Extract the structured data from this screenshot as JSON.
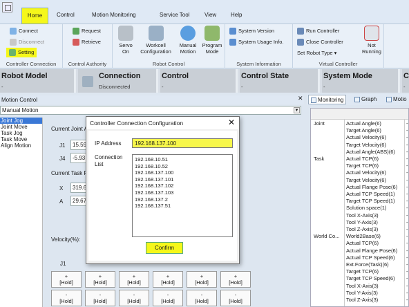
{
  "menu": {
    "items": [
      {
        "label": "Home",
        "active": true
      },
      {
        "label": "Control"
      },
      {
        "label": "Motion Monitoring"
      },
      {
        "label": "Service Tool"
      },
      {
        "label": "View"
      },
      {
        "label": "Help"
      }
    ]
  },
  "ribbon": {
    "controller_connection": {
      "title": "Controller Connection",
      "connect": "Connect",
      "disconnect": "Disconnect",
      "setting": "Setting"
    },
    "control_authority": {
      "title": "Control Authority",
      "request": "Request",
      "retrieve": "Retrieve"
    },
    "robot_control": {
      "title": "Robot Control",
      "servo_on": [
        "Servo",
        "On"
      ],
      "workcell": [
        "Workcell",
        "Configuration"
      ],
      "manual_motion": [
        "Manual",
        "Motion"
      ],
      "program_mode": [
        "Program",
        "Mode"
      ]
    },
    "system_information": {
      "title": "System Information",
      "system_version": "System Version",
      "system_usage": "System Usage Info."
    },
    "virtual_controller": {
      "title": "Virtual Controller",
      "run": "Run Controller",
      "close": "Close Controller",
      "set_robot_type": "Set Robot Type",
      "not_running": [
        "Not",
        "Running"
      ]
    }
  },
  "status": {
    "robot_model": {
      "label": "Robot Model",
      "value": "-"
    },
    "connection": {
      "label": "Connection",
      "value": "Disconnected"
    },
    "control": {
      "label": "Control",
      "value": "-"
    },
    "control_state": {
      "label": "Control State",
      "value": "-"
    },
    "system_mode": {
      "label": "System Mode",
      "value": "-"
    },
    "co": {
      "label": "Co",
      "value": "-"
    }
  },
  "motion_control": {
    "title": "Motion Control",
    "mode": "Manual Motion",
    "list": [
      "Joint Jog",
      "Joint Move",
      "Task Jog",
      "Task Move",
      "Align Motion"
    ],
    "current_joint_label": "Current Joint A",
    "j1_label": "J1",
    "j1_value": "15.59",
    "j4_label": "J4",
    "j4_value": "-5.93",
    "current_task_label": "Current Task P",
    "x_label": "X",
    "x_value": "319.6",
    "a_label": "A",
    "a_value": "29.67",
    "velocity_label": "Velocity(%):",
    "j1_bottom": "J1",
    "hold": "[Hold]",
    "plus": "+",
    "minus": "-"
  },
  "monitoring": {
    "tabs": [
      "Monitoring",
      "Graph",
      "Motio"
    ],
    "rows": [
      {
        "group": "Joint",
        "name": "Actual Angle(6)",
        "val": "-"
      },
      {
        "group": "",
        "name": "Target Angle(6)",
        "val": "-"
      },
      {
        "group": "",
        "name": "Actual Velocity(6)",
        "val": "-"
      },
      {
        "group": "",
        "name": "Target Velocity(6)",
        "val": "-"
      },
      {
        "group": "",
        "name": "Actual Angle(ABS)(6)",
        "val": "-"
      },
      {
        "group": "Task",
        "name": "Actual TCP(6)",
        "val": "-"
      },
      {
        "group": "",
        "name": "Target TCP(6)",
        "val": "-"
      },
      {
        "group": "",
        "name": "Actual Velocity(6)",
        "val": "-"
      },
      {
        "group": "",
        "name": "Target Velocity(6)",
        "val": "-"
      },
      {
        "group": "",
        "name": "Actual Flange Pose(6)",
        "val": "-"
      },
      {
        "group": "",
        "name": "Actual TCP Speed(1)",
        "val": "-"
      },
      {
        "group": "",
        "name": "Target TCP Speed(1)",
        "val": "-"
      },
      {
        "group": "",
        "name": "Solution space(1)",
        "val": "-"
      },
      {
        "group": "",
        "name": "Tool X-Axis(3)",
        "val": "-"
      },
      {
        "group": "",
        "name": "Tool Y-Axis(3)",
        "val": "-"
      },
      {
        "group": "",
        "name": "Tool Z-Axis(3)",
        "val": "-"
      },
      {
        "group": "World Co...",
        "name": "World2Base(6)",
        "val": "-"
      },
      {
        "group": "",
        "name": "Actual TCP(6)",
        "val": "-"
      },
      {
        "group": "",
        "name": "Actual Flange Pose(6)",
        "val": "-"
      },
      {
        "group": "",
        "name": "Actual TCP Speed(6)",
        "val": "-"
      },
      {
        "group": "",
        "name": "Ext.Force(Task)(6)",
        "val": "-"
      },
      {
        "group": "",
        "name": "Target TCP(6)",
        "val": "-"
      },
      {
        "group": "",
        "name": "Target TCP Speed(6)",
        "val": "-"
      },
      {
        "group": "",
        "name": "Tool X-Axis(3)",
        "val": "-"
      },
      {
        "group": "",
        "name": "Tool Y-Axis(3)",
        "val": "-"
      },
      {
        "group": "",
        "name": "Tool Z-Axis(3)",
        "val": "-"
      }
    ]
  },
  "dialog": {
    "title": "Controller Connection Configuration",
    "ip_label": "IP Address",
    "ip_value": "192.168.137.100",
    "list_label": [
      "Connection",
      "List"
    ],
    "connections": [
      "192.168.10.51",
      "192.168.10.52",
      "192.168.137.100",
      "192.168.137.101",
      "192.168.137.102",
      "192.168.137.103",
      "192.168.137.2",
      "192.168.137.51"
    ],
    "confirm": "Confirm",
    "close": "✕"
  },
  "colors": {
    "highlight": "#f5f71a",
    "ribbon": "#e9f0f8",
    "status": "#c9cfd6",
    "selection": "#3a78d6"
  }
}
